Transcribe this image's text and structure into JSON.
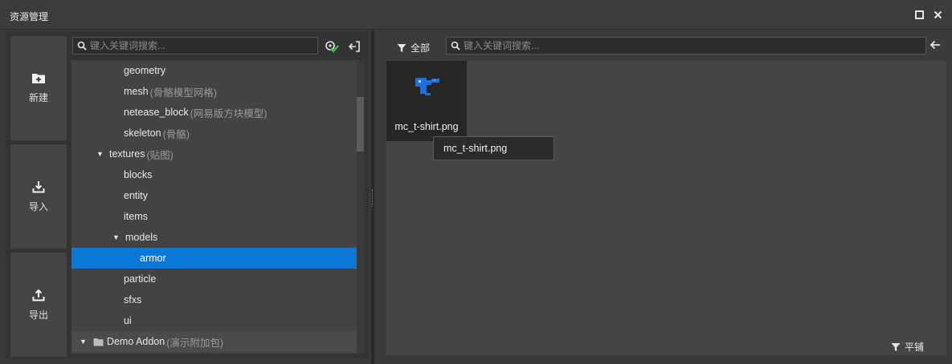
{
  "window": {
    "title": "资源管理"
  },
  "left": {
    "buttons": [
      {
        "label": "新建",
        "icon": "new-folder-icon"
      },
      {
        "label": "导入",
        "icon": "import-icon"
      },
      {
        "label": "导出",
        "icon": "export-icon"
      }
    ],
    "search_placeholder": "键入关键词搜索...",
    "tree": [
      {
        "label": "geometry",
        "sub": "",
        "level": 2,
        "caret": "",
        "selected": false
      },
      {
        "label": "mesh",
        "sub": "(骨骼模型网格)",
        "level": 2,
        "caret": "",
        "selected": false
      },
      {
        "label": "netease_block",
        "sub": "(网易版方块模型)",
        "level": 2,
        "caret": "",
        "selected": false
      },
      {
        "label": "skeleton",
        "sub": "(骨骼)",
        "level": 2,
        "caret": "",
        "selected": false
      },
      {
        "label": "textures",
        "sub": "(贴图)",
        "level": 1,
        "caret": "▼",
        "selected": false
      },
      {
        "label": "blocks",
        "sub": "",
        "level": 2,
        "caret": "",
        "selected": false
      },
      {
        "label": "entity",
        "sub": "",
        "level": 2,
        "caret": "",
        "selected": false
      },
      {
        "label": "items",
        "sub": "",
        "level": 2,
        "caret": "",
        "selected": false
      },
      {
        "label": "models",
        "sub": "",
        "level": 2,
        "caret": "▼",
        "selected": false
      },
      {
        "label": "armor",
        "sub": "",
        "level": 3,
        "caret": "",
        "selected": true
      },
      {
        "label": "particle",
        "sub": "",
        "level": 2,
        "caret": "",
        "selected": false
      },
      {
        "label": "sfxs",
        "sub": "",
        "level": 2,
        "caret": "",
        "selected": false
      },
      {
        "label": "ui",
        "sub": "",
        "level": 2,
        "caret": "",
        "selected": false
      }
    ],
    "footer": {
      "label": "Demo Addon",
      "sub": "(演示附加包)"
    }
  },
  "right": {
    "filter_label": "全部",
    "search_placeholder": "键入关键词搜索...",
    "assets": [
      {
        "name": "mc_t-shirt.png"
      }
    ],
    "tooltip": "mc_t-shirt.png",
    "view_mode_label": "平铺"
  },
  "colors": {
    "selection": "#0a78d7",
    "accent_green": "#2ecc40",
    "icon_blue": "#1e6fe0"
  }
}
